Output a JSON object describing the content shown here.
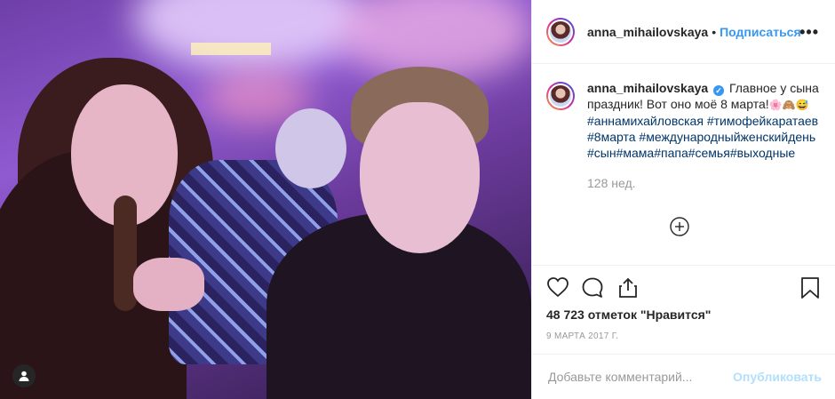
{
  "post": {
    "username": "anna_mihailovskaya",
    "header_separator": "•",
    "follow_label": "Подписаться",
    "more_label": "•••",
    "caption": {
      "username": "anna_mihailovskaya",
      "verified_mark": "✓",
      "text": "Главное у сына праздник! Вот оно моё 8 марта!",
      "emojis": "🌸🙈😅",
      "hashtags": [
        "#аннамихайловская",
        "#тимофейкаратаев",
        "#8марта",
        "#международныйженскийдень",
        "#сын",
        "#мама",
        "#папа",
        "#семья",
        "#выходные"
      ],
      "time_ago": "128 нед."
    },
    "likes": "48 723 отметок \"Нравится\"",
    "date": "9 МАРТА 2017 Г.",
    "comment_placeholder": "Добавьте комментарий...",
    "publish_label": "Опубликовать"
  },
  "icons": {
    "like": "heart-icon",
    "comment": "comment-icon",
    "share": "share-icon",
    "save": "bookmark-icon",
    "load_more": "plus-circle-icon",
    "tagged": "user-tag-icon"
  },
  "colors": {
    "link": "#3897f0",
    "hashtag": "#003569",
    "muted": "#999999",
    "publish_disabled": "#b2dffc"
  }
}
